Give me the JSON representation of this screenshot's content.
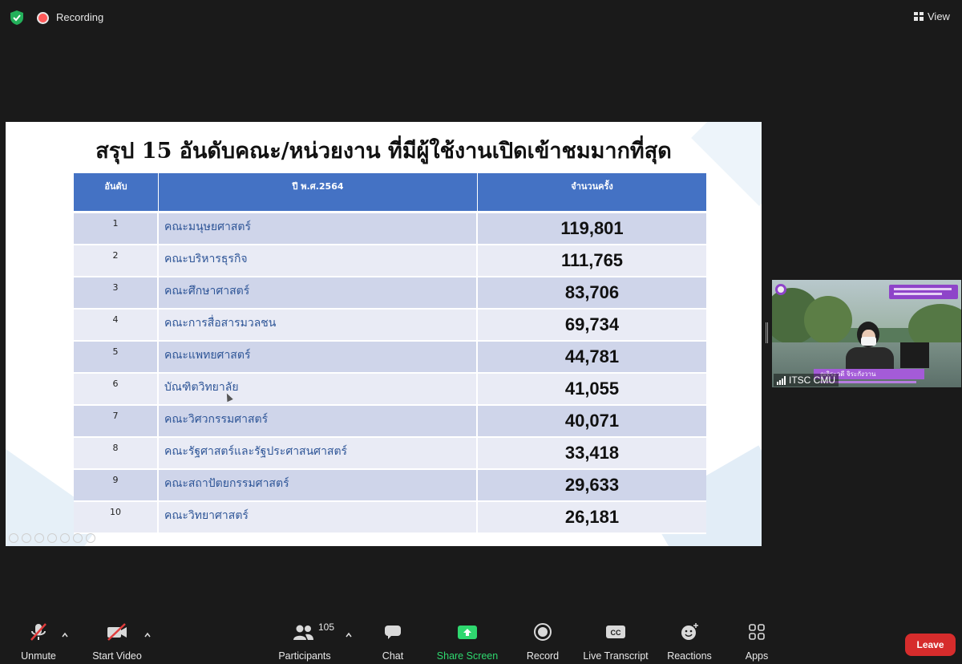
{
  "topbar": {
    "recording_label": "Recording",
    "view_label": "View"
  },
  "slide": {
    "title": "สรุป 15 อันดับคณะ/หน่วยงาน ที่มีผู้ใช้งานเปิดเข้าชมมากที่สุด",
    "columns": [
      "อันดับ",
      "ปี พ.ศ.2564",
      "จำนวนครั้ง"
    ],
    "rows": [
      {
        "rank": "1",
        "name": "คณะมนุษยศาสตร์",
        "count": "119,801"
      },
      {
        "rank": "2",
        "name": "คณะบริหารธุรกิจ",
        "count": "111,765"
      },
      {
        "rank": "3",
        "name": "คณะศึกษาศาสตร์",
        "count": "83,706"
      },
      {
        "rank": "4",
        "name": "คณะการสื่อสารมวลชน",
        "count": "69,734"
      },
      {
        "rank": "5",
        "name": "คณะแพทยศาสตร์",
        "count": "44,781"
      },
      {
        "rank": "6",
        "name": "บัณฑิตวิทยาลัย",
        "count": "41,055"
      },
      {
        "rank": "7",
        "name": "คณะวิศวกรรมศาสตร์",
        "count": "40,071"
      },
      {
        "rank": "8",
        "name": "คณะรัฐศาสตร์และรัฐประศาสนศาสตร์",
        "count": "33,418"
      },
      {
        "rank": "9",
        "name": "คณะสถาปัตยกรรมศาสตร์",
        "count": "29,633"
      },
      {
        "rank": "10",
        "name": "คณะวิทยาศาสตร์",
        "count": "26,181"
      }
    ]
  },
  "video": {
    "participant_label": "ITSC CMU",
    "nameplate": "ณจิระวดี จิระกังวาน"
  },
  "toolbar": {
    "unmute": "Unmute",
    "start_video": "Start Video",
    "participants": "Participants",
    "participants_count": "105",
    "chat": "Chat",
    "share_screen": "Share Screen",
    "record": "Record",
    "live_transcript": "Live Transcript",
    "reactions": "Reactions",
    "apps": "Apps",
    "leave": "Leave",
    "share_color": "#2fd86f",
    "leave_color": "#d62c2c"
  }
}
